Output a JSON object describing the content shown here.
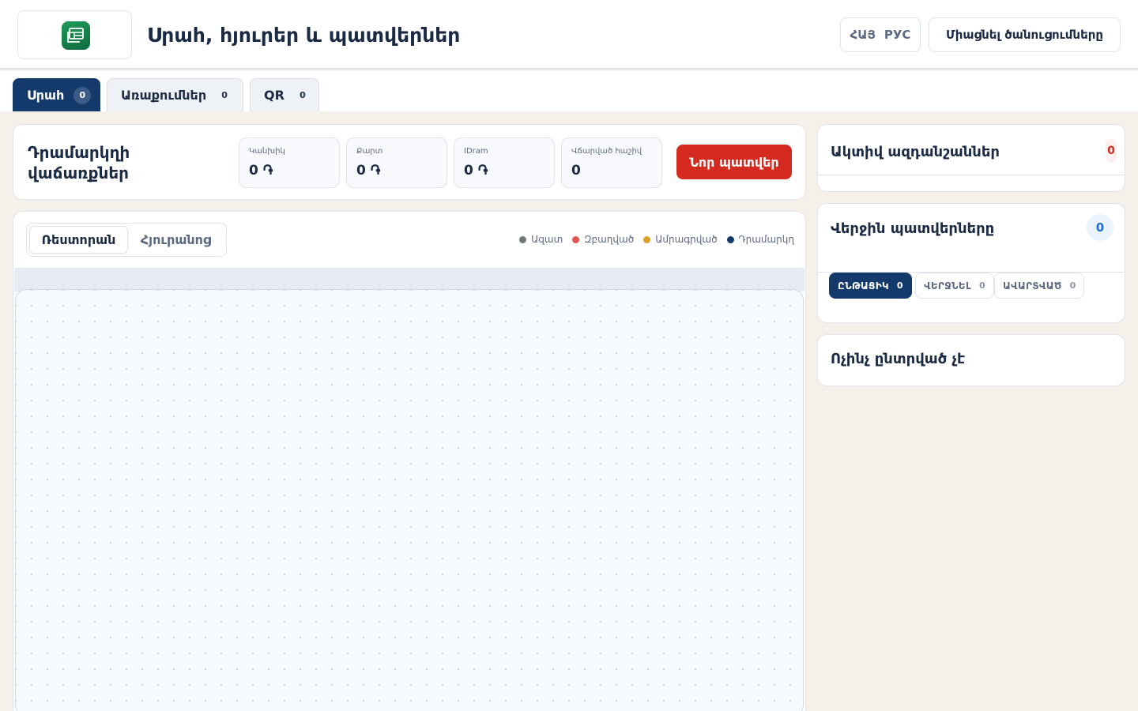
{
  "header": {
    "title": "Սրահ, հյուրեր և պատվերներ",
    "lang_hy": "ՀԱՅ",
    "lang_ru": "РУС",
    "connect_label": "Միացնել ծանուցումները"
  },
  "tabs": [
    {
      "label": "Սրահ",
      "count": "0"
    },
    {
      "label": "Առաքումներ",
      "count": "0"
    },
    {
      "label": "QR",
      "count": "0"
    }
  ],
  "sales": {
    "title": "Դրամարկղի վաճառքներ",
    "stats": [
      {
        "label": "Կանխիկ",
        "value": "0 ֏"
      },
      {
        "label": "Քարտ",
        "value": "0 ֏"
      },
      {
        "label": "IDram",
        "value": "0 ֏"
      },
      {
        "label": "Վճարված հաշիվ",
        "value": "0"
      }
    ],
    "new_order_label": "Նոր պատվեր"
  },
  "floor": {
    "segments": [
      "Ռեստորան",
      "Հյուրանոց"
    ],
    "legend": [
      {
        "label": "Ազատ",
        "color": "#6f7a78"
      },
      {
        "label": "Զբաղված",
        "color": "#e2564d"
      },
      {
        "label": "Ամրագրված",
        "color": "#d9a02b"
      },
      {
        "label": "Դրամարկղ",
        "color": "#143a6b"
      }
    ]
  },
  "alerts": {
    "title": "Ակտիվ ազդանշաններ",
    "count": "0"
  },
  "recent_orders": {
    "title": "Վերջին պատվերները",
    "count": "0",
    "filters": [
      {
        "label": "ԸՆԹԱՑԻԿ",
        "count": "0"
      },
      {
        "label": "ՎԵՐՋՆԵԼ",
        "count": "0"
      },
      {
        "label": "ԱՎԱՐՏՎԱԾ",
        "count": "0"
      }
    ]
  },
  "selection": {
    "empty_label": "Ոչինչ ընտրված չէ"
  },
  "colors": {
    "primary": "#143a6b",
    "danger": "#d42a1f",
    "accent_blue": "#1e6fd9",
    "background": "#f5f1ea"
  }
}
